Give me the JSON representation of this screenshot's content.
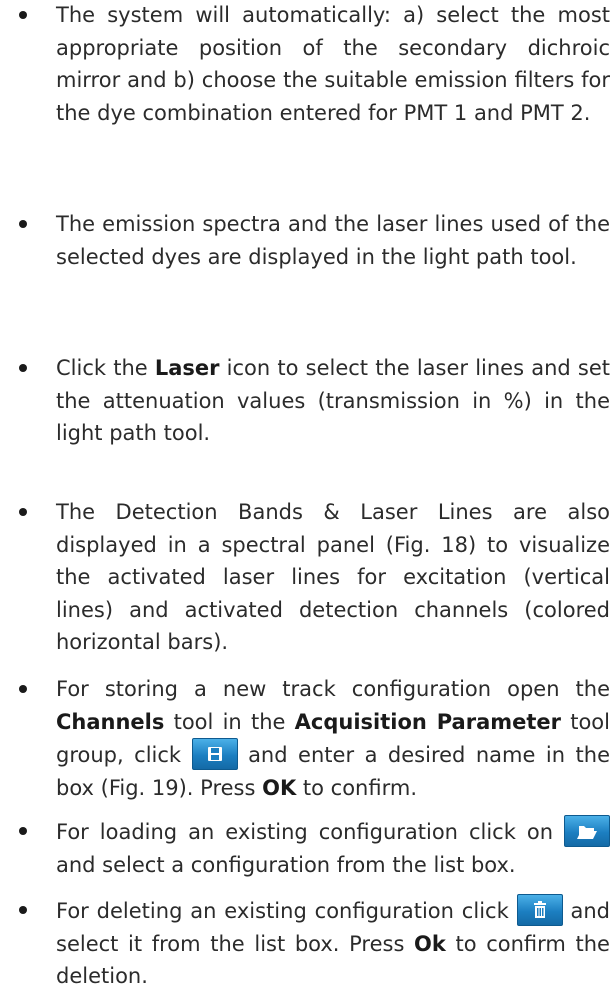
{
  "bullets": [
    {
      "text": "The system will automatically: a) select the most appropriate position of the secondary dichroic mirror and b) choose the suitable emission filters for the dye combination entered for PMT 1 and PMT 2."
    },
    {
      "text": "The emission spectra and the laser lines used of the selected dyes are displayed in the light path tool."
    },
    {
      "pre": "Click the ",
      "bold": "Laser",
      "post": " icon to select the laser lines and set the attenuation values (transmission in %) in the light path tool."
    },
    {
      "text": "The Detection Bands & Laser Lines are also displayed in a spectral panel (Fig. 18) to visualize the activated laser lines for excitation (vertical lines) and activated detection channels (colored horizontal bars)."
    },
    {
      "p1": "For storing a new track configuration open the ",
      "b1": "Channels",
      "p2": " tool in the ",
      "b2": "Acquisition Parameter",
      "p3": " tool group, click ",
      "p4": " and enter a desired name in the box (Fig. 19). Press ",
      "b3": "OK",
      "p5": " to confirm.",
      "icon": "save-icon"
    },
    {
      "p1": "For loading an existing configuration click on ",
      "p2": " and select a configuration from the list box.",
      "icon": "folder-open-icon"
    },
    {
      "p1": "For deleting an existing configuration click ",
      "p2": " and select it from the list box. Press ",
      "b1": "Ok",
      "p3": " to confirm the deletion.",
      "icon": "trash-icon"
    }
  ]
}
